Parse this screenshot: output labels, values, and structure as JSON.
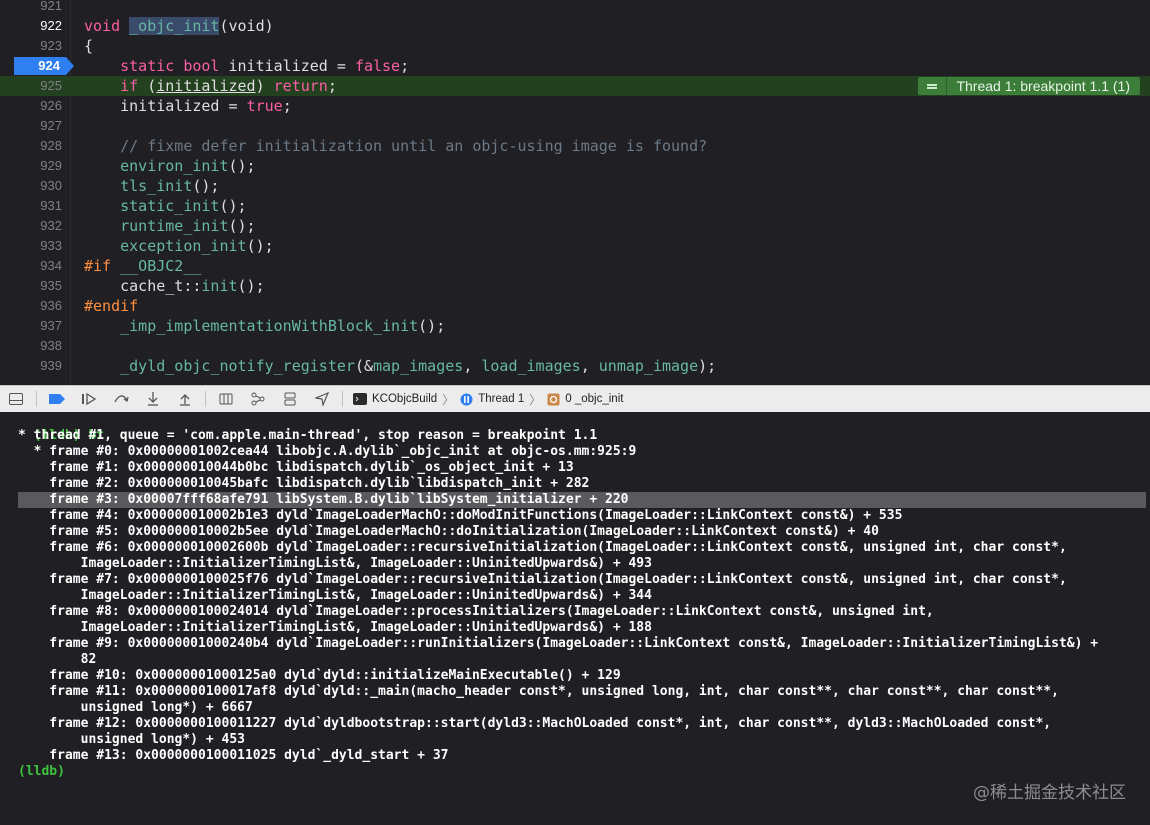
{
  "editor": {
    "lines": [
      {
        "num": "921"
      },
      {
        "num": "922"
      },
      {
        "num": "923"
      },
      {
        "num": "924"
      },
      {
        "num": "925"
      },
      {
        "num": "926"
      },
      {
        "num": "927"
      },
      {
        "num": "928"
      },
      {
        "num": "929"
      },
      {
        "num": "930"
      },
      {
        "num": "931"
      },
      {
        "num": "932"
      },
      {
        "num": "933"
      },
      {
        "num": "934"
      },
      {
        "num": "935"
      },
      {
        "num": "936"
      },
      {
        "num": "937"
      },
      {
        "num": "938"
      },
      {
        "num": "939"
      }
    ],
    "code": {
      "l922_kw": "void",
      "l922_fn": "_objc_init",
      "l922_rest": "(void)",
      "l923": "{",
      "l924_kw1": "static",
      "l924_kw2": "bool",
      "l924_mid": " initialized = ",
      "l924_val": "false",
      "l924_end": ";",
      "l925_kw": "if",
      "l925_var": "initialized",
      "l925_ret": "return",
      "l926_a": "initialized = ",
      "l926_val": "true",
      "l926_end": ";",
      "l928": "// fixme defer initialization until an objc-using image is found?",
      "l929": "environ_init",
      "l930": "tls_init",
      "l931": "static_init",
      "l932": "runtime_init",
      "l933": "exception_init",
      "l934_pp": "#if",
      "l934_macro": "__OBJC2__",
      "l935_a": "cache_t::",
      "l935_fn": "init",
      "l936": "#endif",
      "l937": "_imp_implementationWithBlock_init",
      "l939_fn": "_dyld_objc_notify_register",
      "l939_a1": "map_images",
      "l939_a2": "load_images",
      "l939_a3": "unmap_image"
    },
    "thread_badge": "Thread 1: breakpoint 1.1 (1)"
  },
  "toolbar": {
    "breadcrumb": [
      "KCObjcBuild",
      "Thread 1",
      "0 _objc_init"
    ]
  },
  "console": {
    "lines": [
      "(lldb) bt",
      "* thread #1, queue = 'com.apple.main-thread', stop reason = breakpoint 1.1",
      "  * frame #0: 0x00000001002cea44 libobjc.A.dylib`_objc_init at objc-os.mm:925:9",
      "    frame #1: 0x000000010044b0bc libdispatch.dylib`_os_object_init + 13",
      "    frame #2: 0x000000010045bafc libdispatch.dylib`libdispatch_init + 282",
      "    frame #3: 0x00007fff68afe791 libSystem.B.dylib`libSystem_initializer + 220",
      "    frame #4: 0x000000010002b1e3 dyld`ImageLoaderMachO::doModInitFunctions(ImageLoader::LinkContext const&) + 535",
      "    frame #5: 0x000000010002b5ee dyld`ImageLoaderMachO::doInitialization(ImageLoader::LinkContext const&) + 40",
      "    frame #6: 0x000000010002600b dyld`ImageLoader::recursiveInitialization(ImageLoader::LinkContext const&, unsigned int, char const*,",
      "        ImageLoader::InitializerTimingList&, ImageLoader::UninitedUpwards&) + 493",
      "    frame #7: 0x0000000100025f76 dyld`ImageLoader::recursiveInitialization(ImageLoader::LinkContext const&, unsigned int, char const*,",
      "        ImageLoader::InitializerTimingList&, ImageLoader::UninitedUpwards&) + 344",
      "    frame #8: 0x0000000100024014 dyld`ImageLoader::processInitializers(ImageLoader::LinkContext const&, unsigned int,",
      "        ImageLoader::InitializerTimingList&, ImageLoader::UninitedUpwards&) + 188",
      "    frame #9: 0x00000001000240b4 dyld`ImageLoader::runInitializers(ImageLoader::LinkContext const&, ImageLoader::InitializerTimingList&) +",
      "        82",
      "    frame #10: 0x00000001000125a0 dyld`dyld::initializeMainExecutable() + 129",
      "    frame #11: 0x0000000100017af8 dyld`dyld::_main(macho_header const*, unsigned long, int, char const**, char const**, char const**,",
      "        unsigned long*) + 6667",
      "    frame #12: 0x0000000100011227 dyld`dyldbootstrap::start(dyld3::MachOLoaded const*, int, char const**, dyld3::MachOLoaded const*,",
      "        unsigned long*) + 453",
      "    frame #13: 0x0000000100011025 dyld`_dyld_start + 37",
      "(lldb)"
    ]
  },
  "watermark": "@稀土掘金技术社区",
  "colors": {
    "editor_bg": "#1f1f24",
    "keyword": "#fc5fa3",
    "function": "#67b7a4",
    "comment": "#6c7986",
    "preprocessor": "#fd8f3f",
    "current_line": "#23401f",
    "breakpoint": "#2f7ff0",
    "thread_badge": "#3c7d3a",
    "prompt": "#3ec43e"
  }
}
